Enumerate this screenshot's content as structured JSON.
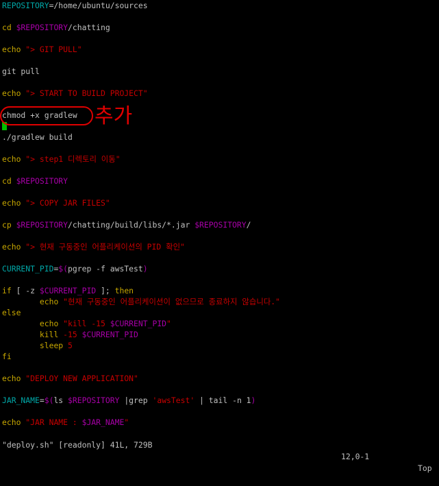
{
  "editor": {
    "lines": [
      {
        "t": 0,
        "parts": [
          {
            "c": "cyan",
            "s": "REPOSITORY"
          },
          {
            "c": "white",
            "s": "=/home/ubuntu/sources"
          }
        ]
      },
      {
        "t": 32,
        "parts": [
          {
            "c": "yellow",
            "s": "cd "
          },
          {
            "c": "magenta",
            "s": "$REPOSITORY"
          },
          {
            "c": "white",
            "s": "/chatting"
          }
        ]
      },
      {
        "t": 64,
        "parts": [
          {
            "c": "yellow",
            "s": "echo "
          },
          {
            "c": "red",
            "s": "\"> GIT PULL\""
          }
        ]
      },
      {
        "t": 96,
        "parts": [
          {
            "c": "white",
            "s": "git pull"
          }
        ]
      },
      {
        "t": 128,
        "parts": [
          {
            "c": "yellow",
            "s": "echo "
          },
          {
            "c": "red",
            "s": "\"> START TO BUILD PROJECT\""
          }
        ]
      },
      {
        "t": 160,
        "parts": [
          {
            "c": "white",
            "s": "chmod "
          },
          {
            "c": "white",
            "s": "+x gradlew"
          }
        ]
      },
      {
        "t": 192,
        "parts": [
          {
            "c": "white",
            "s": "./gradlew build"
          }
        ]
      },
      {
        "t": 224,
        "parts": [
          {
            "c": "yellow",
            "s": "echo "
          },
          {
            "c": "red",
            "s": "\"> step1 디렉토리 이동\""
          }
        ]
      },
      {
        "t": 256,
        "parts": [
          {
            "c": "yellow",
            "s": "cd "
          },
          {
            "c": "magenta",
            "s": "$REPOSITORY"
          }
        ]
      },
      {
        "t": 288,
        "parts": [
          {
            "c": "yellow",
            "s": "echo "
          },
          {
            "c": "red",
            "s": "\"> COPY JAR FILES\""
          }
        ]
      },
      {
        "t": 320,
        "parts": [
          {
            "c": "yellow",
            "s": "cp "
          },
          {
            "c": "magenta",
            "s": "$REPOSITORY"
          },
          {
            "c": "white",
            "s": "/chatting/build/libs/*.jar "
          },
          {
            "c": "magenta",
            "s": "$REPOSITORY"
          },
          {
            "c": "white",
            "s": "/"
          }
        ]
      },
      {
        "t": 352,
        "parts": [
          {
            "c": "yellow",
            "s": "echo "
          },
          {
            "c": "red",
            "s": "\"> 현재 구동중인 어플리케이션의 PID 확인\""
          }
        ]
      },
      {
        "t": 384,
        "parts": [
          {
            "c": "cyan",
            "s": "CURRENT_PID"
          },
          {
            "c": "white",
            "s": "="
          },
          {
            "c": "magenta",
            "s": "$("
          },
          {
            "c": "white",
            "s": "pgrep -f awsTest"
          },
          {
            "c": "magenta",
            "s": ")"
          }
        ]
      },
      {
        "t": 416,
        "parts": [
          {
            "c": "yellow",
            "s": "if "
          },
          {
            "c": "white",
            "s": "[ -z "
          },
          {
            "c": "magenta",
            "s": "$CURRENT_PID"
          },
          {
            "c": "white",
            "s": " ]; "
          },
          {
            "c": "yellow",
            "s": "then"
          }
        ]
      },
      {
        "t": 432,
        "parts": [
          {
            "c": "white",
            "s": "        "
          },
          {
            "c": "yellow",
            "s": "echo "
          },
          {
            "c": "red",
            "s": "\"현재 구동중인 어플리케이션이 없으므로 종료하지 않습니다.\""
          }
        ]
      },
      {
        "t": 448,
        "parts": [
          {
            "c": "yellow",
            "s": "else"
          }
        ]
      },
      {
        "t": 464,
        "parts": [
          {
            "c": "white",
            "s": "        "
          },
          {
            "c": "yellow",
            "s": "echo "
          },
          {
            "c": "red",
            "s": "\"kill -15 "
          },
          {
            "c": "magenta",
            "s": "$CURRENT_PID"
          },
          {
            "c": "red",
            "s": "\""
          }
        ]
      },
      {
        "t": 480,
        "parts": [
          {
            "c": "white",
            "s": "        "
          },
          {
            "c": "yellow",
            "s": "kill "
          },
          {
            "c": "red",
            "s": "-15 "
          },
          {
            "c": "magenta",
            "s": "$CURRENT_PID"
          }
        ]
      },
      {
        "t": 496,
        "parts": [
          {
            "c": "white",
            "s": "        "
          },
          {
            "c": "yellow",
            "s": "sleep "
          },
          {
            "c": "red",
            "s": "5"
          }
        ]
      },
      {
        "t": 512,
        "parts": [
          {
            "c": "yellow",
            "s": "fi"
          }
        ]
      },
      {
        "t": 544,
        "parts": [
          {
            "c": "yellow",
            "s": "echo "
          },
          {
            "c": "red",
            "s": "\"DEPLOY NEW APPLICATION\""
          }
        ]
      },
      {
        "t": 576,
        "parts": [
          {
            "c": "cyan",
            "s": "JAR_NAME"
          },
          {
            "c": "white",
            "s": "="
          },
          {
            "c": "magenta",
            "s": "$("
          },
          {
            "c": "white",
            "s": "ls "
          },
          {
            "c": "magenta",
            "s": "$REPOSITORY"
          },
          {
            "c": "white",
            "s": " |grep "
          },
          {
            "c": "red",
            "s": "'awsTest'"
          },
          {
            "c": "white",
            "s": " | tail -n 1"
          },
          {
            "c": "magenta",
            "s": ")"
          }
        ]
      },
      {
        "t": 608,
        "parts": [
          {
            "c": "yellow",
            "s": "echo "
          },
          {
            "c": "red",
            "s": "\"JAR NAME : "
          },
          {
            "c": "magenta",
            "s": "$JAR_NAME"
          },
          {
            "c": "red",
            "s": "\""
          }
        ]
      }
    ]
  },
  "annotation": {
    "text": "추가"
  },
  "status": {
    "file_info": "\"deploy.sh\" [readonly] 41L, 729B",
    "position": "12,0-1",
    "scroll": "Top"
  },
  "colors": {
    "background": "#000000",
    "cyan": "#00a8a8",
    "yellow": "#c8a800",
    "magenta": "#a800a8",
    "red": "#c80000",
    "white": "#c0c0c0",
    "annotation": "#e00000",
    "cursor": "#00c000"
  }
}
